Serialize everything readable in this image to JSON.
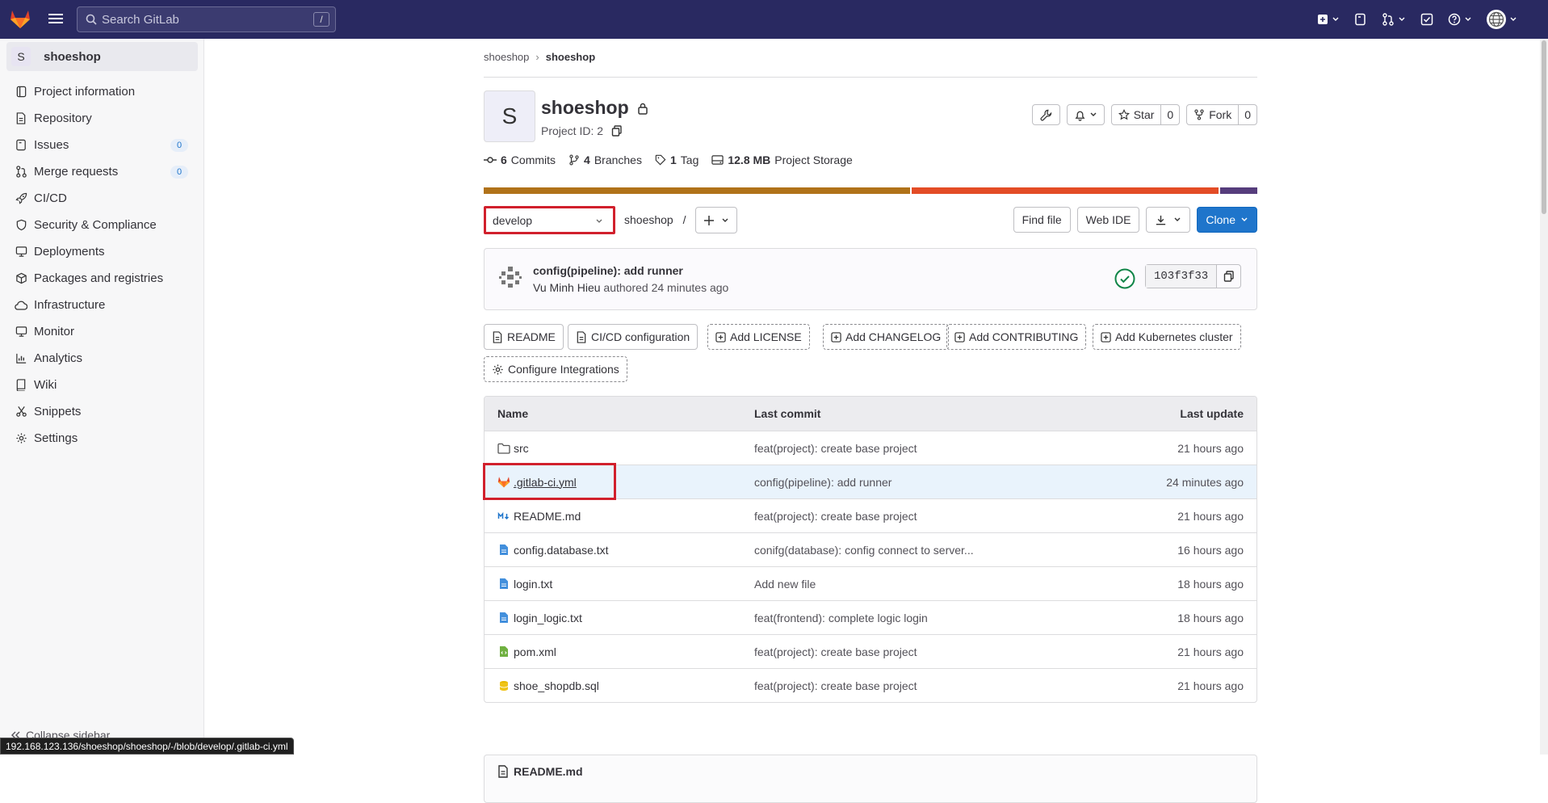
{
  "topbar": {
    "search_placeholder": "Search GitLab",
    "search_shortcut": "/"
  },
  "sidebar": {
    "project_letter": "S",
    "project_name": "shoeshop",
    "items": [
      {
        "label": "Project information",
        "icon": "info-icon"
      },
      {
        "label": "Repository",
        "icon": "doc-icon"
      },
      {
        "label": "Issues",
        "icon": "issues-icon",
        "count": "0"
      },
      {
        "label": "Merge requests",
        "icon": "merge-request-icon",
        "count": "0"
      },
      {
        "label": "CI/CD",
        "icon": "rocket-icon"
      },
      {
        "label": "Security & Compliance",
        "icon": "shield-icon"
      },
      {
        "label": "Deployments",
        "icon": "deployments-icon"
      },
      {
        "label": "Packages and registries",
        "icon": "package-icon"
      },
      {
        "label": "Infrastructure",
        "icon": "cloud-icon"
      },
      {
        "label": "Monitor",
        "icon": "monitor-icon"
      },
      {
        "label": "Analytics",
        "icon": "chart-icon"
      },
      {
        "label": "Wiki",
        "icon": "book-icon"
      },
      {
        "label": "Snippets",
        "icon": "snippet-icon"
      },
      {
        "label": "Settings",
        "icon": "gear-icon"
      }
    ],
    "collapse_label": "Collapse sidebar"
  },
  "status_url": "192.168.123.136/shoeshop/shoeshop/-/blob/develop/.gitlab-ci.yml",
  "breadcrumb": {
    "parent": "shoeshop",
    "current": "shoeshop"
  },
  "project": {
    "letter": "S",
    "name": "shoeshop",
    "id_label": "Project ID: 2",
    "star_label": "Star",
    "star_count": "0",
    "fork_label": "Fork",
    "fork_count": "0"
  },
  "stats": {
    "commits_num": "6",
    "commits_label": "Commits",
    "branches_num": "4",
    "branches_label": "Branches",
    "tags_num": "1",
    "tags_label": "Tag",
    "storage_num": "12.8 MB",
    "storage_label": "Project Storage"
  },
  "language_bar": [
    {
      "color": "#b07219",
      "percent": 55.3
    },
    {
      "color": "#e34c26",
      "percent": 39.9
    },
    {
      "color": "#563d7c",
      "percent": 4.8
    }
  ],
  "repo": {
    "branch": "develop",
    "path": "shoeshop",
    "path_sep": "/",
    "find_file": "Find file",
    "web_ide": "Web IDE",
    "clone": "Clone"
  },
  "last_commit": {
    "message": "config(pipeline): add runner",
    "author": "Vu Minh Hieu",
    "authored": "authored",
    "time": "24 minutes ago",
    "sha": "103f3f33"
  },
  "quick_buttons": [
    {
      "label": "README",
      "style": "solid",
      "icon": "doc-icon"
    },
    {
      "label": "CI/CD configuration",
      "style": "solid",
      "icon": "doc-icon"
    },
    {
      "label": "Add LICENSE",
      "style": "dash",
      "icon": "plus-square-icon"
    },
    {
      "label": "Add CHANGELOG",
      "style": "dash",
      "icon": "plus-square-icon"
    },
    {
      "label": "Add CONTRIBUTING",
      "style": "dash",
      "icon": "plus-square-icon"
    },
    {
      "label": "Add Kubernetes cluster",
      "style": "dash",
      "icon": "plus-square-icon"
    },
    {
      "label": "Configure Integrations",
      "style": "dash",
      "icon": "gear-icon"
    }
  ],
  "files": {
    "headers": {
      "name": "Name",
      "commit": "Last commit",
      "update": "Last update"
    },
    "rows": [
      {
        "name": "src",
        "icon": "folder-icon",
        "commit": "feat(project): create base project",
        "update": "21 hours ago"
      },
      {
        "name": ".gitlab-ci.yml",
        "icon": "gitlab-icon",
        "commit": "config(pipeline): add runner",
        "update": "24 minutes ago"
      },
      {
        "name": "README.md",
        "icon": "markdown-icon",
        "commit": "feat(project): create base project",
        "update": "21 hours ago"
      },
      {
        "name": "config.database.txt",
        "icon": "file-icon",
        "commit": "conifg(database): config connect to server...",
        "update": "16 hours ago"
      },
      {
        "name": "login.txt",
        "icon": "file-icon",
        "commit": "Add new file",
        "update": "18 hours ago"
      },
      {
        "name": "login_logic.txt",
        "icon": "file-icon",
        "commit": "feat(frontend): complete logic login",
        "update": "18 hours ago"
      },
      {
        "name": "pom.xml",
        "icon": "xml-icon",
        "commit": "feat(project): create base project",
        "update": "21 hours ago"
      },
      {
        "name": "shoe_shopdb.sql",
        "icon": "database-icon",
        "commit": "feat(project): create base project",
        "update": "21 hours ago"
      }
    ]
  },
  "readme_title": "README.md"
}
